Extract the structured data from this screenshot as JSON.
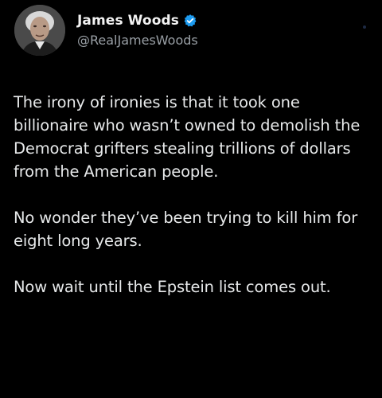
{
  "author": {
    "display_name": "James Woods",
    "handle": "@RealJamesWoods",
    "verified": true,
    "avatar_icon": "profile-photo",
    "verified_icon": "verified-badge-icon"
  },
  "tweet": {
    "paragraphs": [
      "The irony of ironies is that it took one billionaire who wasn’t owned to demolish the Democrat grifters stealing trillions of dollars from the American people.",
      "No wonder they’ve been trying to kill him for eight long years.",
      "Now wait until the Epstein list comes out."
    ]
  },
  "colors": {
    "background": "#000000",
    "text": "#e7e9ea",
    "handle": "#9aa0a6",
    "verified": "#1d9bf0"
  }
}
